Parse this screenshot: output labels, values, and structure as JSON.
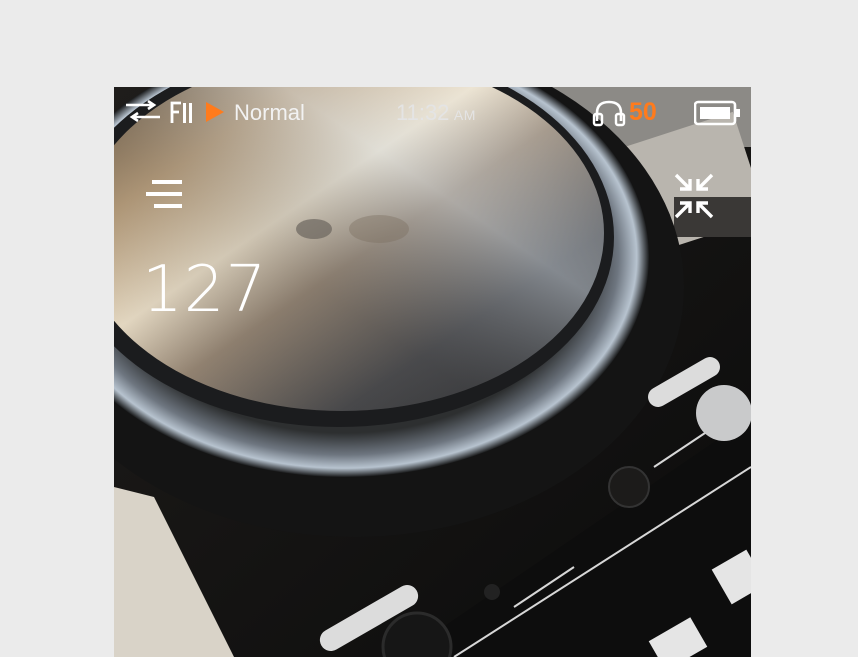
{
  "status_bar": {
    "playback_mode": "Normal",
    "time": "11:32",
    "time_suffix": "AM",
    "volume": "50",
    "icons": [
      "shuffle-icon",
      "repeat-all-icon",
      "play-icon",
      "headphone-icon",
      "battery-icon"
    ]
  },
  "player": {
    "bpm": "127",
    "menu_icon": "menu-icon",
    "collapse_icon": "collapse-icon"
  },
  "colors": {
    "accent": "#ff7b1c",
    "page_background": "#ebebeb",
    "text": "#ffffff"
  }
}
